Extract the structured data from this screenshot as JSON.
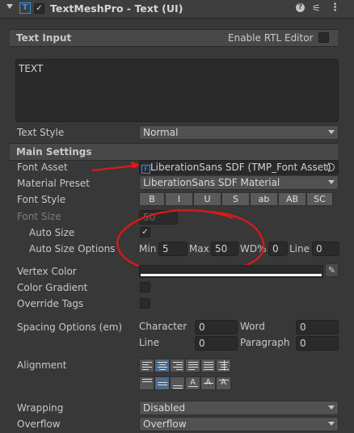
{
  "header": {
    "title": "TextMeshPro - Text (UI)"
  },
  "text_input": {
    "title": "Text Input",
    "rtl_label": "Enable RTL Editor",
    "text": "TEXT"
  },
  "text_style": {
    "label": "Text Style",
    "value": "Normal"
  },
  "main_settings": {
    "title": "Main Settings"
  },
  "font_asset": {
    "label": "Font Asset",
    "value": "LiberationSans SDF (TMP_Font Asset)"
  },
  "material_preset": {
    "label": "Material Preset",
    "value": "LiberationSans SDF Material"
  },
  "font_style": {
    "label": "Font Style",
    "buttons": [
      "B",
      "I",
      "U",
      "S",
      "ab",
      "AB",
      "SC"
    ]
  },
  "font_size": {
    "label": "Font Size",
    "value": "50"
  },
  "auto_size": {
    "label": "Auto Size",
    "checkmark": "✓"
  },
  "auto_size_options": {
    "label": "Auto Size Options",
    "min_label": "Min",
    "min_value": "5",
    "max_label": "Max",
    "max_value": "50",
    "wd_label": "WD%",
    "wd_value": "0",
    "line_label": "Line",
    "line_value": "0"
  },
  "vertex_color": {
    "label": "Vertex Color",
    "color": "#ffffff"
  },
  "color_gradient": {
    "label": "Color Gradient"
  },
  "override_tags": {
    "label": "Override Tags"
  },
  "spacing": {
    "label": "Spacing Options (em)",
    "character_label": "Character",
    "character_value": "0",
    "word_label": "Word",
    "word_value": "0",
    "line_label": "Line",
    "line_value": "0",
    "paragraph_label": "Paragraph",
    "paragraph_value": "0"
  },
  "alignment": {
    "label": "Alignment"
  },
  "wrapping": {
    "label": "Wrapping",
    "value": "Disabled"
  },
  "overflow": {
    "label": "Overflow",
    "value": "Overflow"
  },
  "colors": {
    "annotation": "#e01818",
    "icon_blue": "#3a8ee6"
  }
}
